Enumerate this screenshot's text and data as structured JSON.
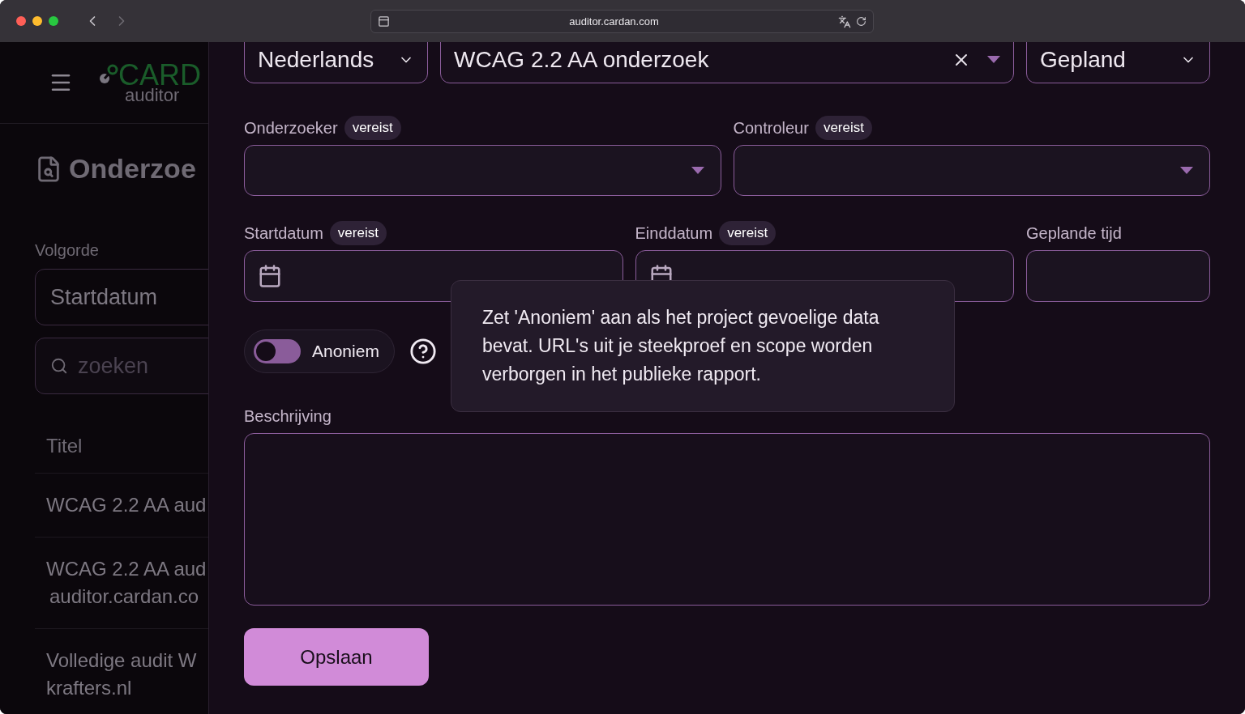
{
  "browser": {
    "url": "auditor.cardan.com"
  },
  "sidebar": {
    "logo": {
      "brand": "CARD",
      "sub": "auditor"
    },
    "title": "Onderzoe",
    "sort": {
      "label": "Volgorde",
      "value": "Startdatum"
    },
    "search": {
      "placeholder": "zoeken"
    },
    "table": {
      "column": "Titel",
      "rows": [
        {
          "lines": [
            "WCAG 2.2 AA aud"
          ]
        },
        {
          "lines": [
            "WCAG 2.2 AA aud",
            "auditor.cardan.co"
          ]
        },
        {
          "lines": [
            "Volledige audit W",
            "krafters.nl"
          ]
        }
      ]
    }
  },
  "form": {
    "top_row": [
      {
        "kind": "select",
        "value": "Nederlands"
      },
      {
        "kind": "combobox",
        "value": "WCAG 2.2 AA onderzoek"
      },
      {
        "kind": "select",
        "value": "Gepland"
      }
    ],
    "people": [
      {
        "label": "Onderzoeker",
        "badge": "vereist"
      },
      {
        "label": "Controleur",
        "badge": "vereist"
      }
    ],
    "dates": [
      {
        "kind": "date",
        "label": "Startdatum",
        "badge": "vereist"
      },
      {
        "kind": "date",
        "label": "Einddatum",
        "badge": "vereist"
      },
      {
        "kind": "text",
        "label": "Geplande tijd"
      }
    ],
    "anonymous": {
      "label": "Anoniem",
      "on": false
    },
    "tooltip": "Zet 'Anoniem' aan als het project gevoelige data bevat. URL's uit je steekproef en scope worden verborgen in het publieke rapport.",
    "description": {
      "label": "Beschrijving"
    },
    "save": "Opslaan"
  }
}
